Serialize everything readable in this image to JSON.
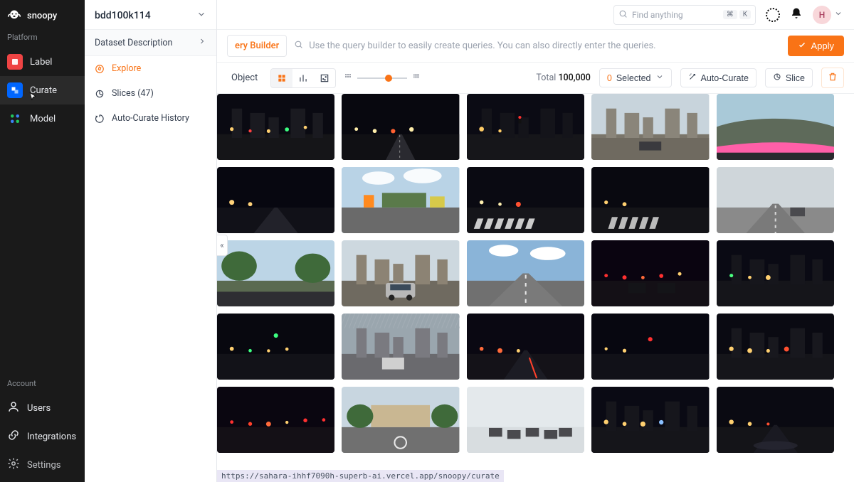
{
  "brand": "snoopy",
  "sidebar": {
    "section_platform": "Platform",
    "items": [
      {
        "label": "Label"
      },
      {
        "label": "Curate"
      },
      {
        "label": "Model"
      }
    ],
    "section_account": "Account",
    "account_items": [
      {
        "label": "Users"
      },
      {
        "label": "Integrations"
      },
      {
        "label": "Settings"
      }
    ]
  },
  "panel": {
    "dataset_name": "bdd100k114",
    "section_title": "Dataset Description",
    "items": [
      {
        "label": "Explore"
      },
      {
        "label": "Slices (47)"
      },
      {
        "label": "Auto-Curate History"
      }
    ]
  },
  "topbar": {
    "search_placeholder": "Find anything",
    "kbd1": "⌘",
    "kbd2": "K",
    "avatar_initial": "H"
  },
  "query": {
    "builder_label": "ery Builder",
    "placeholder": "Use the query builder to easily create queries. You can also directly enter the queries.",
    "apply_label": "Apply"
  },
  "toolbar": {
    "tab_object": "Object",
    "total_label": "Total",
    "total_value": "100,000",
    "selected_count": "0",
    "selected_label": "Selected",
    "auto_curate": "Auto-Curate",
    "slice": "Slice"
  },
  "collapse_glyph": "«",
  "statusbar_url": "https://sahara-ihhf7090h-superb-ai.vercel.app/snoopy/curate",
  "thumbs": [
    {
      "type": "night_street"
    },
    {
      "type": "night_highway"
    },
    {
      "type": "night_intersection"
    },
    {
      "type": "day_city_tall"
    },
    {
      "type": "day_dashboard_pink"
    },
    {
      "type": "night_empty"
    },
    {
      "type": "day_construction"
    },
    {
      "type": "night_crosswalk"
    },
    {
      "type": "night_crosswalk2"
    },
    {
      "type": "day_overcast_highway"
    },
    {
      "type": "day_trees"
    },
    {
      "type": "day_city_car"
    },
    {
      "type": "day_freeway"
    },
    {
      "type": "night_traffic_red"
    },
    {
      "type": "night_intersection2"
    },
    {
      "type": "night_green"
    },
    {
      "type": "day_rain"
    },
    {
      "type": "night_trail"
    },
    {
      "type": "night_red_dot"
    },
    {
      "type": "night_street2"
    },
    {
      "type": "night_taillights"
    },
    {
      "type": "day_campus"
    },
    {
      "type": "day_snow_traffic"
    },
    {
      "type": "night_city"
    },
    {
      "type": "night_wet"
    }
  ]
}
